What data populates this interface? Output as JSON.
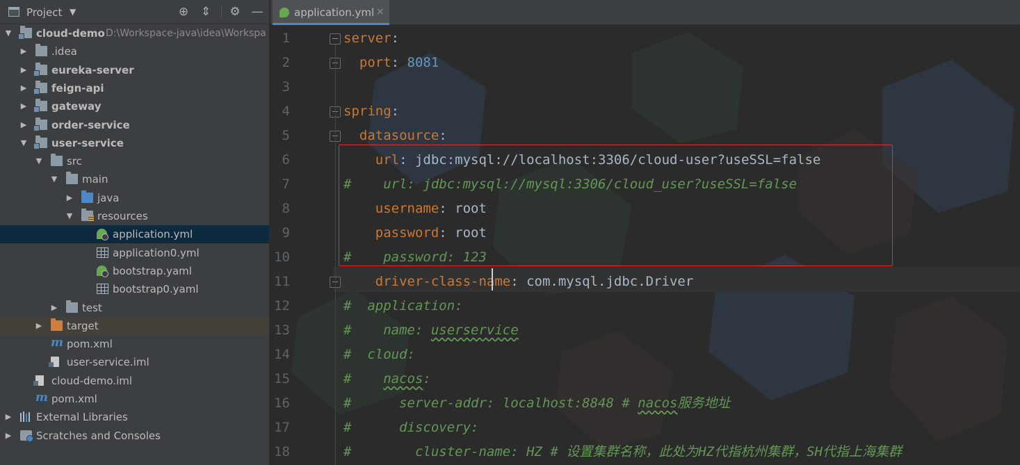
{
  "project_panel": {
    "title": "Project",
    "tree": [
      {
        "label": "cloud-demo",
        "path": "D:\\Workspace-java\\idea\\Workspa",
        "bold": true,
        "depth": 0,
        "arrow": "down",
        "icon": "module-folder-icon"
      },
      {
        "label": ".idea",
        "bold": false,
        "depth": 1,
        "arrow": "right",
        "icon": "folder-icon"
      },
      {
        "label": "eureka-server",
        "bold": true,
        "depth": 1,
        "arrow": "right",
        "icon": "module-folder-icon"
      },
      {
        "label": "feign-api",
        "bold": true,
        "depth": 1,
        "arrow": "right",
        "icon": "module-folder-icon"
      },
      {
        "label": "gateway",
        "bold": true,
        "depth": 1,
        "arrow": "right",
        "icon": "module-folder-icon"
      },
      {
        "label": "order-service",
        "bold": true,
        "depth": 1,
        "arrow": "right",
        "icon": "module-folder-icon"
      },
      {
        "label": "user-service",
        "bold": true,
        "depth": 1,
        "arrow": "down",
        "icon": "module-folder-icon"
      },
      {
        "label": "src",
        "bold": false,
        "depth": 2,
        "arrow": "down",
        "icon": "folder-icon"
      },
      {
        "label": "main",
        "bold": false,
        "depth": 3,
        "arrow": "down",
        "icon": "folder-icon"
      },
      {
        "label": "java",
        "bold": false,
        "depth": 4,
        "arrow": "right",
        "icon": "source-folder-icon"
      },
      {
        "label": "resources",
        "bold": false,
        "depth": 4,
        "arrow": "down",
        "icon": "resources-folder-icon"
      },
      {
        "label": "application.yml",
        "bold": false,
        "depth": 5,
        "arrow": "",
        "icon": "spring-config-icon",
        "selected": true
      },
      {
        "label": "application0.yml",
        "bold": false,
        "depth": 5,
        "arrow": "",
        "icon": "yaml-file-icon"
      },
      {
        "label": "bootstrap.yaml",
        "bold": false,
        "depth": 5,
        "arrow": "",
        "icon": "spring-config-icon"
      },
      {
        "label": "bootstrap0.yaml",
        "bold": false,
        "depth": 5,
        "arrow": "",
        "icon": "yaml-file-icon"
      },
      {
        "label": "test",
        "bold": false,
        "depth": 3,
        "arrow": "right",
        "icon": "folder-icon"
      },
      {
        "label": "target",
        "bold": false,
        "depth": 2,
        "arrow": "right",
        "icon": "excluded-folder-icon",
        "excluded": true
      },
      {
        "label": "pom.xml",
        "bold": false,
        "depth": 2,
        "arrow": "",
        "icon": "maven-icon"
      },
      {
        "label": "user-service.iml",
        "bold": false,
        "depth": 2,
        "arrow": "",
        "icon": "iml-file-icon"
      },
      {
        "label": "cloud-demo.iml",
        "bold": false,
        "depth": 1,
        "arrow": "",
        "icon": "iml-file-icon"
      },
      {
        "label": "pom.xml",
        "bold": false,
        "depth": 1,
        "arrow": "",
        "icon": "maven-icon"
      },
      {
        "label": "External Libraries",
        "bold": false,
        "depth": 0,
        "arrow": "right",
        "icon": "libraries-icon"
      },
      {
        "label": "Scratches and Consoles",
        "bold": false,
        "depth": 0,
        "arrow": "right",
        "icon": "scratches-icon"
      }
    ]
  },
  "editor": {
    "tab": {
      "label": "application.yml",
      "close": "×"
    },
    "lines": [
      {
        "n": "1",
        "segs": [
          {
            "t": "server",
            "c": "k"
          },
          {
            "t": ":",
            "c": "v"
          }
        ]
      },
      {
        "n": "2",
        "segs": [
          {
            "t": "  port",
            "c": "k"
          },
          {
            "t": ": ",
            "c": "v"
          },
          {
            "t": "8081",
            "c": "n"
          }
        ]
      },
      {
        "n": "3",
        "segs": []
      },
      {
        "n": "4",
        "segs": [
          {
            "t": "spring",
            "c": "k"
          },
          {
            "t": ":",
            "c": "v"
          }
        ]
      },
      {
        "n": "5",
        "segs": [
          {
            "t": "  datasource",
            "c": "k"
          },
          {
            "t": ":",
            "c": "v"
          }
        ]
      },
      {
        "n": "6",
        "segs": [
          {
            "t": "    url",
            "c": "k"
          },
          {
            "t": ": jdbc:mysql://localhost:3306/cloud-user?useSSL=false",
            "c": "v"
          }
        ]
      },
      {
        "n": "7",
        "segs": [
          {
            "t": "#    url: jdbc:mysql://mysql:3306/cloud_user?useSSL=false",
            "c": "c"
          }
        ]
      },
      {
        "n": "8",
        "segs": [
          {
            "t": "    username",
            "c": "k"
          },
          {
            "t": ": root",
            "c": "v"
          }
        ]
      },
      {
        "n": "9",
        "segs": [
          {
            "t": "    password",
            "c": "k"
          },
          {
            "t": ": root",
            "c": "v"
          }
        ]
      },
      {
        "n": "10",
        "segs": [
          {
            "t": "#    password: 123",
            "c": "c"
          }
        ]
      },
      {
        "n": "11",
        "segs": [
          {
            "t": "    driver-class-name",
            "c": "k"
          },
          {
            "t": ": com.mysql.jdbc.Driver",
            "c": "v"
          }
        ]
      },
      {
        "n": "12",
        "segs": [
          {
            "t": "#  application:",
            "c": "c"
          }
        ]
      },
      {
        "n": "13",
        "segs": [
          {
            "t": "#    name: ",
            "c": "c"
          },
          {
            "t": "userservice",
            "c": "c u"
          }
        ]
      },
      {
        "n": "14",
        "segs": [
          {
            "t": "#  cloud:",
            "c": "c"
          }
        ]
      },
      {
        "n": "15",
        "segs": [
          {
            "t": "#    ",
            "c": "c"
          },
          {
            "t": "nacos",
            "c": "c u"
          },
          {
            "t": ":",
            "c": "c"
          }
        ]
      },
      {
        "n": "16",
        "segs": [
          {
            "t": "#      server-addr: localhost:8848 # ",
            "c": "c"
          },
          {
            "t": "nacos",
            "c": "c u"
          },
          {
            "t": "服务地址",
            "c": "c"
          }
        ]
      },
      {
        "n": "17",
        "segs": [
          {
            "t": "#      discovery:",
            "c": "c"
          }
        ]
      },
      {
        "n": "18",
        "segs": [
          {
            "t": "#        cluster-name: HZ # 设置集群名称，此处为HZ代指杭州集群，SH代指上海集群",
            "c": "c"
          }
        ]
      }
    ]
  },
  "colors": {
    "keyword": "#cc7832",
    "number": "#6897bb",
    "comment": "#629755",
    "text": "#a9b7c6",
    "highlight_box": "#e03131"
  }
}
